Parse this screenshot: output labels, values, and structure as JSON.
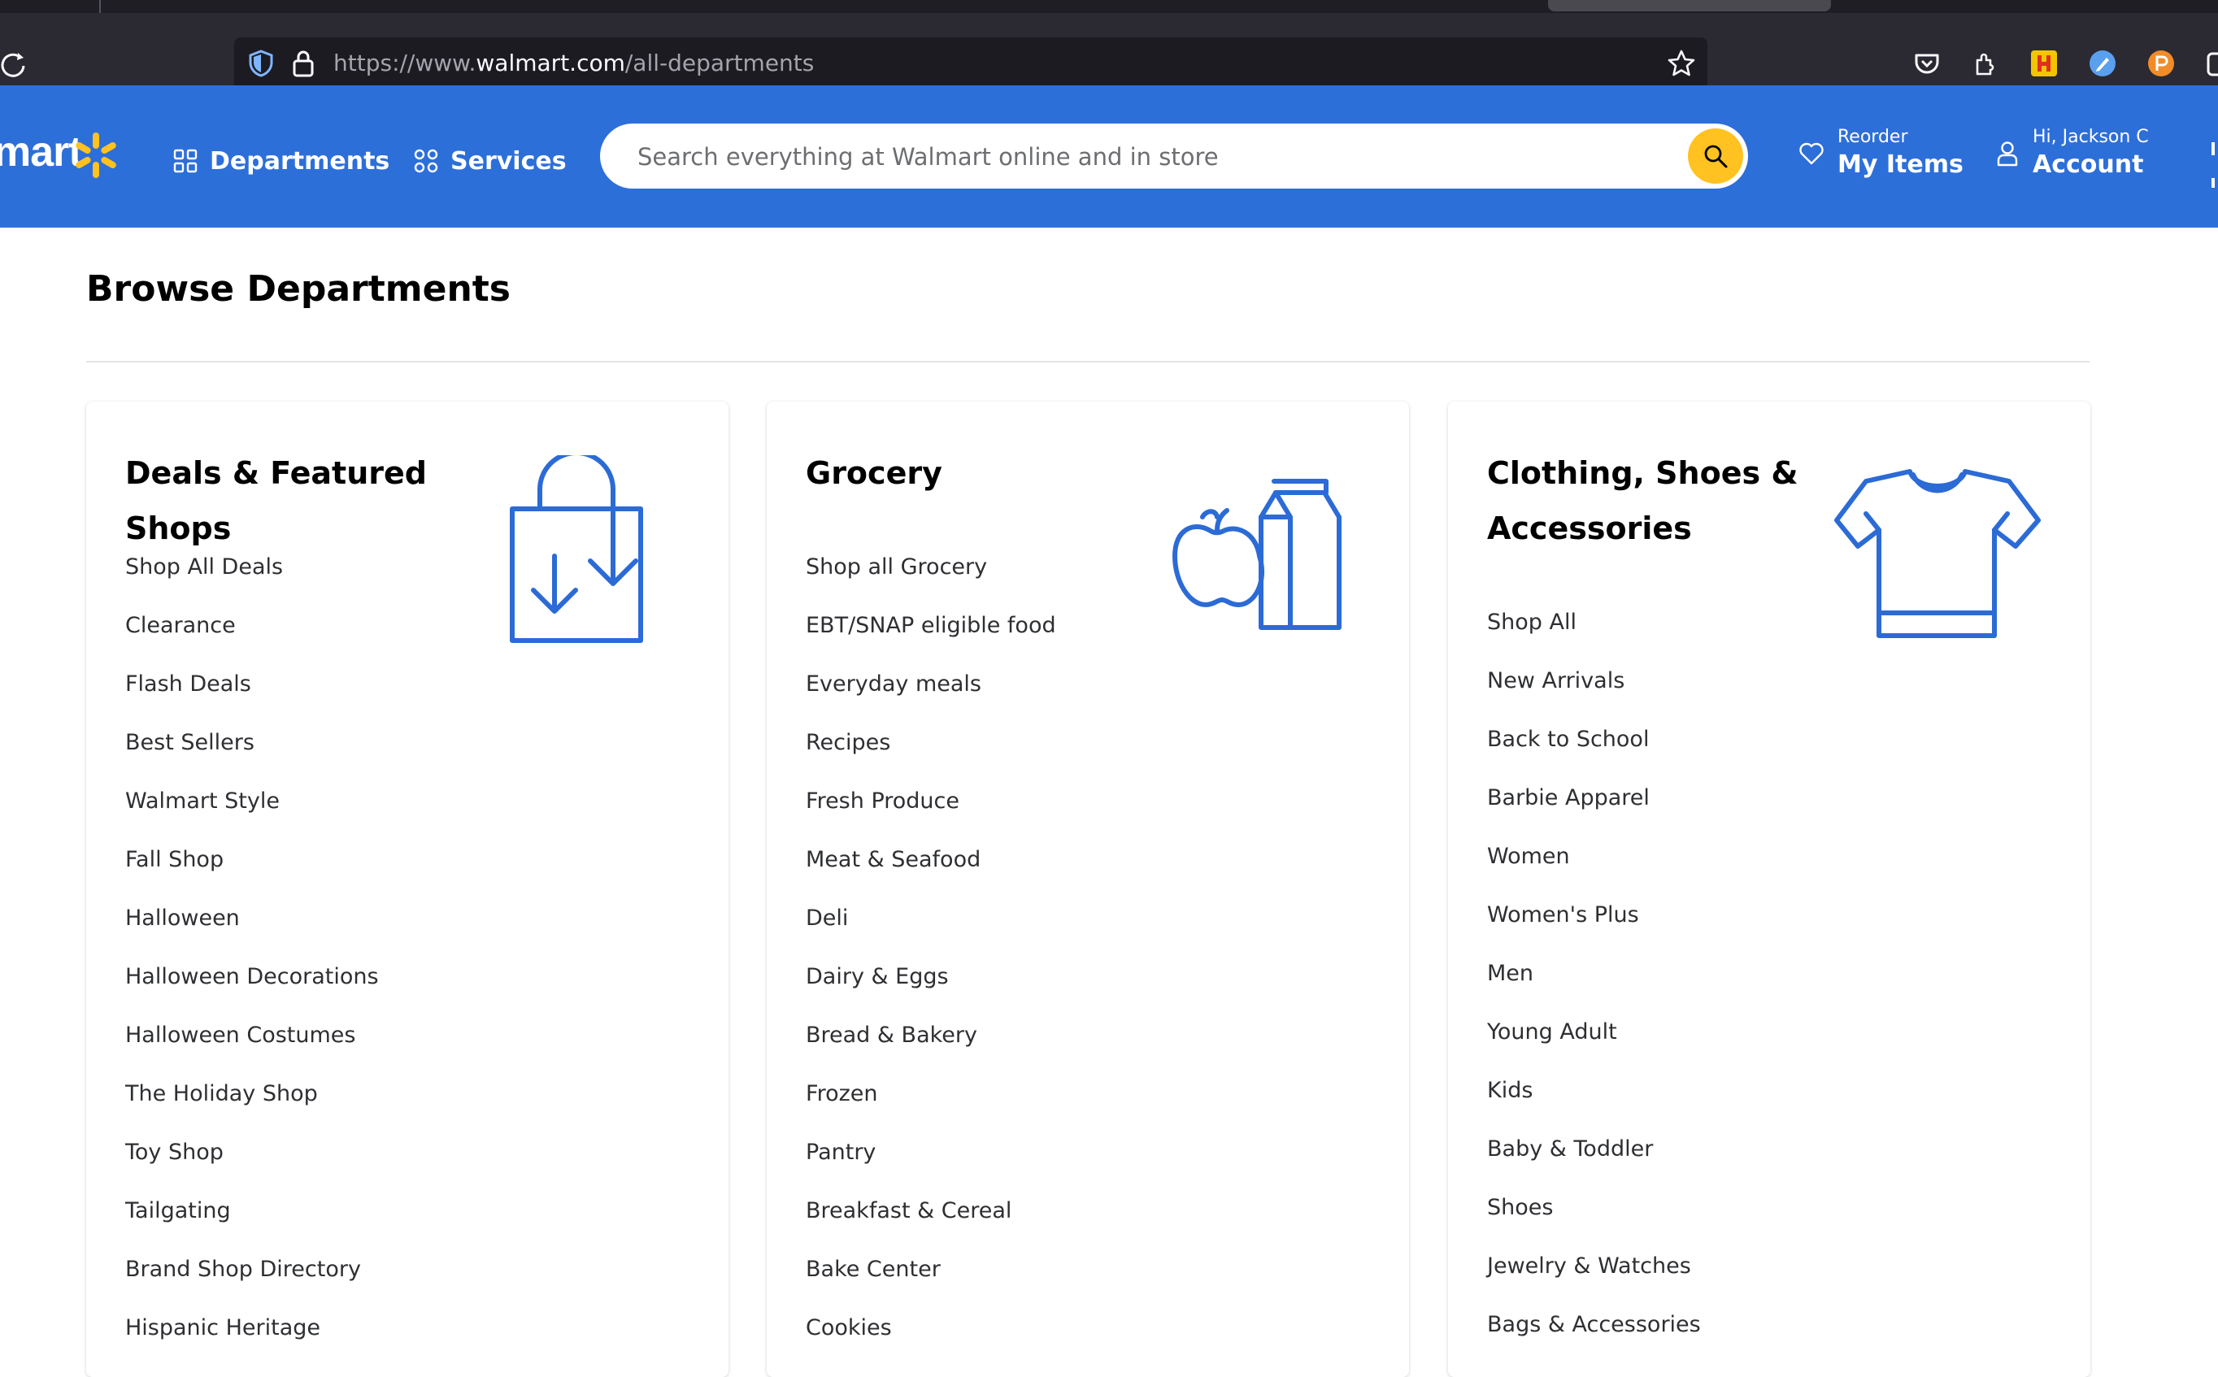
{
  "browser": {
    "url_prefix": "https://www.",
    "url_domain": "walmart.com",
    "url_path": "/all-departments"
  },
  "header": {
    "logo_text": "mart",
    "departments_label": "Departments",
    "services_label": "Services",
    "search_placeholder": "Search everything at Walmart online and in store",
    "reorder_small": "Reorder",
    "reorder_big": "My Items",
    "account_small": "Hi, Jackson C",
    "account_big": "Account"
  },
  "page": {
    "title": "Browse Departments"
  },
  "colors": {
    "walmart_blue": "#2d6fd9",
    "spark_yellow": "#ffc220",
    "icon_blue": "#2c6bd6"
  },
  "cards": [
    {
      "title": "Deals & Featured Shops",
      "icon": "shopping-bag-icon",
      "links": [
        "Shop All Deals",
        "Clearance",
        "Flash Deals",
        "Best Sellers",
        "Walmart Style",
        "Fall Shop",
        "Halloween",
        "Halloween Decorations",
        "Halloween Costumes",
        "The Holiday Shop",
        "Toy Shop",
        "Tailgating",
        "Brand Shop Directory",
        "Hispanic Heritage"
      ]
    },
    {
      "title": "Grocery",
      "icon": "apple-milk-icon",
      "links": [
        "Shop all Grocery",
        "EBT/SNAP eligible food",
        "Everyday meals",
        "Recipes",
        "Fresh Produce",
        "Meat & Seafood",
        "Deli",
        "Dairy & Eggs",
        "Bread & Bakery",
        "Frozen",
        "Pantry",
        "Breakfast & Cereal",
        "Bake Center",
        "Cookies"
      ]
    },
    {
      "title": "Clothing, Shoes & Accessories",
      "icon": "tshirt-icon",
      "links": [
        "Shop All",
        "New Arrivals",
        "Back to School",
        "Barbie Apparel",
        "Women",
        "Women's Plus",
        "Men",
        "Young Adult",
        "Kids",
        "Baby & Toddler",
        "Shoes",
        "Jewelry & Watches",
        "Bags & Accessories"
      ]
    }
  ]
}
